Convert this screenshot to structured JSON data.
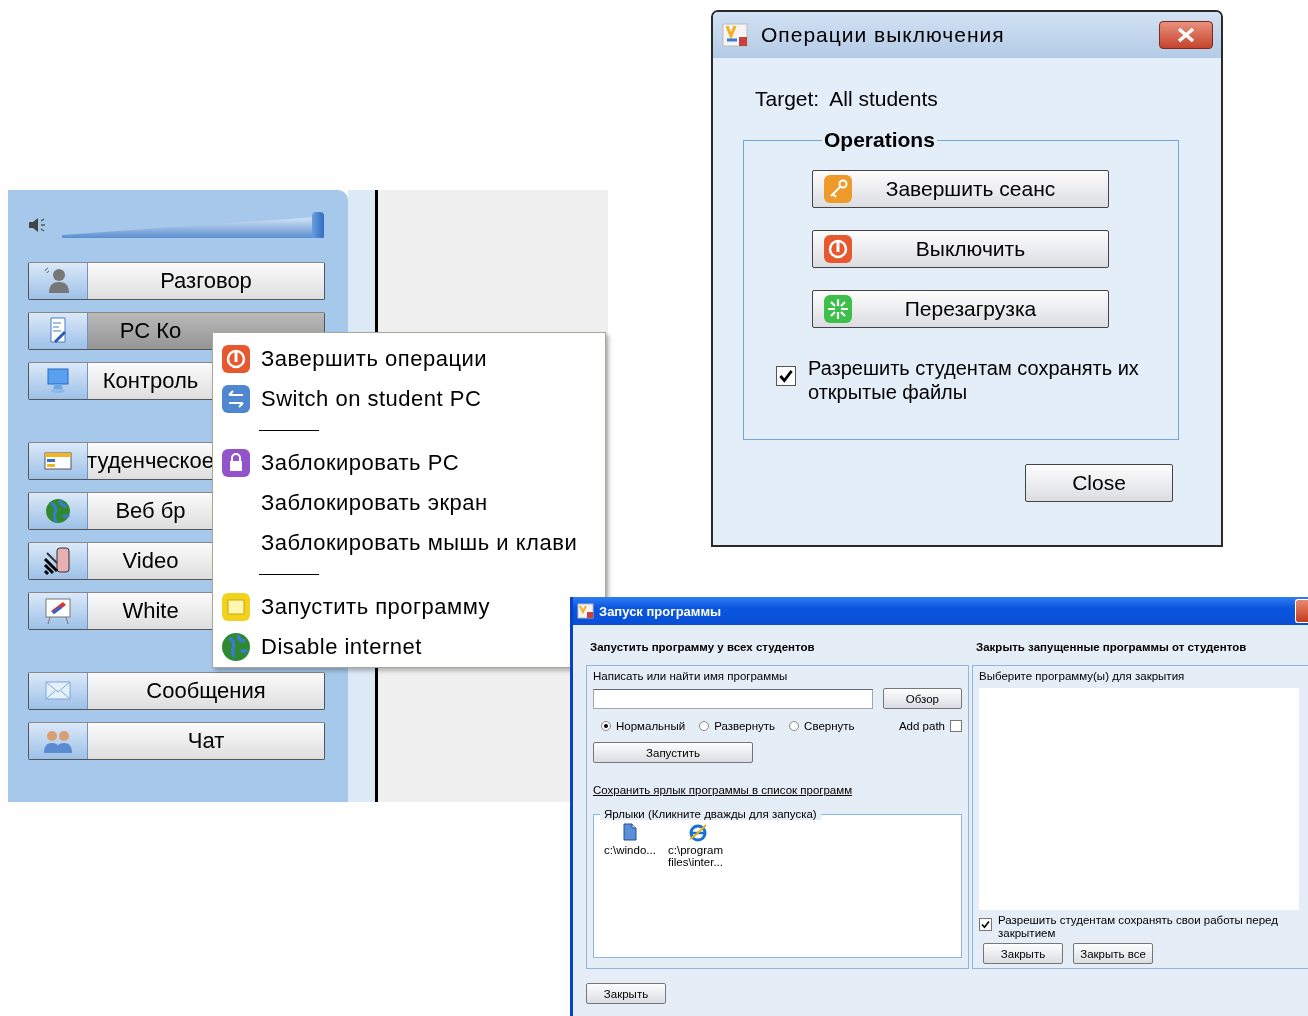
{
  "launcher": {
    "volume": {
      "level": 1
    },
    "groups": [
      [
        {
          "label": "Разговор",
          "selected": false,
          "covered": false
        },
        {
          "label": "PC Ко",
          "selected": true,
          "covered": true
        },
        {
          "label": "Контроль",
          "selected": false,
          "covered": true
        }
      ],
      [
        {
          "label": "туденческое",
          "selected": false,
          "covered": true
        },
        {
          "label": "Веб бр",
          "selected": false,
          "covered": true
        },
        {
          "label": "Video",
          "selected": false,
          "covered": true
        },
        {
          "label": "White",
          "selected": false,
          "covered": true
        }
      ],
      [
        {
          "label": "Сообщения",
          "selected": false,
          "covered": false
        },
        {
          "label": "Чат",
          "selected": false,
          "covered": false
        }
      ]
    ],
    "context_menu": [
      {
        "kind": "item",
        "label": "Завершить операции"
      },
      {
        "kind": "item",
        "label": "Switch on student PC"
      },
      {
        "kind": "separator"
      },
      {
        "kind": "item",
        "label": "Заблокировать PC"
      },
      {
        "kind": "item",
        "label": "Заблокировать экран"
      },
      {
        "kind": "item",
        "label": "Заблокировать мышь и клави"
      },
      {
        "kind": "separator"
      },
      {
        "kind": "item",
        "label": "Запустить программу"
      },
      {
        "kind": "item",
        "label": "Disable internet"
      }
    ]
  },
  "shutdown_dialog": {
    "title": "Операции выключения",
    "target_label": "Target:",
    "target_value": "All students",
    "group_title": "Operations",
    "buttons": [
      "Завершить сеанс",
      "Выключить",
      "Перезагрузка"
    ],
    "allow_save": {
      "label": "Разрешить студентам сохранять их открытые файлы",
      "checked": true
    },
    "close_button": "Close"
  },
  "run_dialog": {
    "title": "Запуск программы",
    "launch": {
      "heading": "Запустить программу у всех студентов",
      "field_label": "Написать или найти имя программы",
      "browse_button": "Обзор",
      "window_modes": [
        {
          "label": "Нормальный",
          "selected": true
        },
        {
          "label": "Развернуть",
          "selected": false
        },
        {
          "label": "Свернуть",
          "selected": false
        }
      ],
      "add_path": {
        "label": "Add path",
        "checked": false
      },
      "run_button": "Запустить",
      "save_link": "Сохранить ярлык программы в список программ",
      "shortcuts": {
        "title": "Ярлыки (Кликните дважды для запуска)",
        "items": [
          {
            "label": "c:\\windo..."
          },
          {
            "label": "c:\\program files\\inter..."
          }
        ]
      }
    },
    "close_programs": {
      "heading": "Закрыть запущенные программы от студентов",
      "list_label": "Выберите программу(ы) для закрытия",
      "allow_save": {
        "label": "Разрешить студентам сохранять свои работы перед закрытием",
        "checked": true
      },
      "buttons": [
        "Закрыть",
        "Закрыть все"
      ]
    },
    "close_button": "Закрыть"
  }
}
